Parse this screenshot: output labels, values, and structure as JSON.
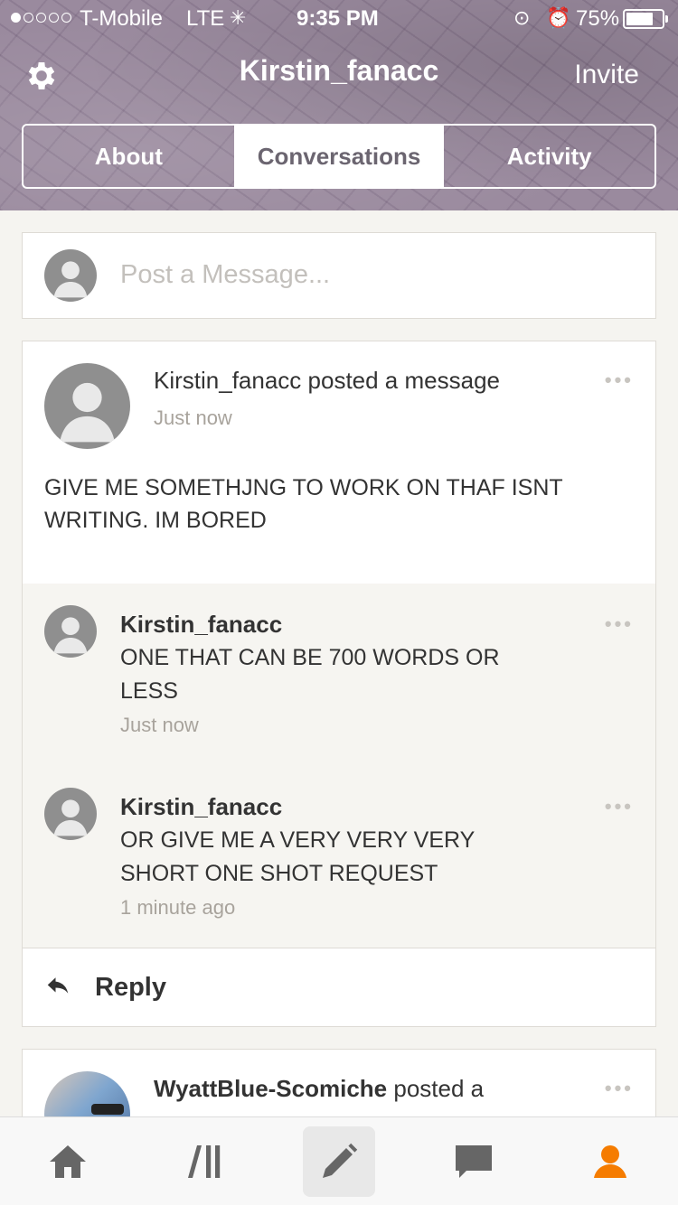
{
  "status_bar": {
    "carrier": "T-Mobile",
    "network": "LTE",
    "time": "9:35 PM",
    "battery_text": "75%",
    "battery_level": 0.75,
    "signal_bars": 1
  },
  "header": {
    "title": "Kirstin_fanacc",
    "invite_label": "Invite",
    "tabs": [
      {
        "label": "About",
        "active": false
      },
      {
        "label": "Conversations",
        "active": true
      },
      {
        "label": "Activity",
        "active": false
      }
    ]
  },
  "composer": {
    "placeholder": "Post a Message..."
  },
  "posts": [
    {
      "header": "Kirstin_fanacc posted a message",
      "time": "Just now",
      "body": "GIVE ME SOMETHJNG TO WORK ON THAF ISNT WRITING. IM BORED",
      "replies": [
        {
          "author": "Kirstin_fanacc",
          "text": "ONE THAT CAN BE 700 WORDS OR LESS",
          "time": "Just now"
        },
        {
          "author": "Kirstin_fanacc",
          "text": "OR GIVE ME A VERY VERY VERY SHORT ONE SHOT REQUEST",
          "time": "1 minute ago"
        }
      ],
      "reply_label": "Reply"
    },
    {
      "author": "WyattBlue-Scomiche",
      "action": " posted a"
    }
  ],
  "more_icon": "•••",
  "nav": {
    "items": [
      "home-icon",
      "library-icon",
      "write-icon",
      "inbox-icon",
      "profile-icon"
    ],
    "active": "profile-icon",
    "active_color": "#f57c00"
  }
}
